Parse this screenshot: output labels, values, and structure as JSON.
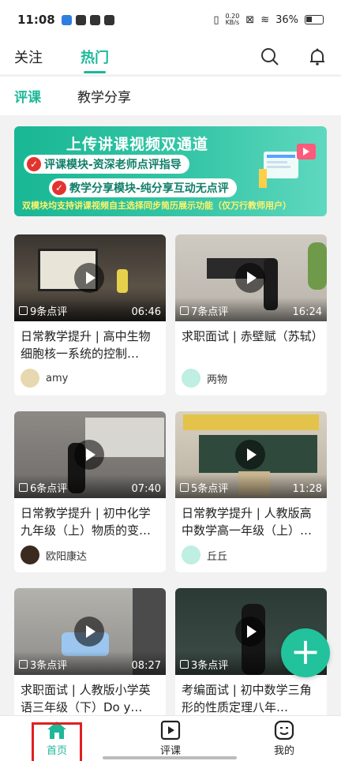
{
  "status_bar": {
    "time": "11:08",
    "net_rate_value": "0.20",
    "net_rate_unit": "KB/s",
    "battery": "36%"
  },
  "top_tabs": [
    {
      "label": "关注"
    },
    {
      "label": "热门"
    }
  ],
  "sub_tabs": [
    {
      "label": "评课"
    },
    {
      "label": "教学分享"
    }
  ],
  "banner": {
    "title": "上传讲课视频双通道",
    "line1": "评课模块-资深老师点评指导",
    "line2": "教学分享模块-纯分享互动无点评",
    "note": "双模块均支持讲课视频自主选择同步简历展示功能（仅万行教师用户）"
  },
  "cards": [
    {
      "comments": "9条点评",
      "duration": "06:46",
      "title": "日常教学提升 | 高中生物细胞核一系统的控制…",
      "author": "amy"
    },
    {
      "comments": "7条点评",
      "duration": "16:24",
      "title": "求职面试 | 赤壁赋（苏轼）",
      "author": "两物"
    },
    {
      "comments": "6条点评",
      "duration": "07:40",
      "title": "日常教学提升 | 初中化学九年级（上）物质的变…",
      "author": "欧阳康达"
    },
    {
      "comments": "5条点评",
      "duration": "11:28",
      "title": "日常教学提升 | 人教版高中数学高一年级（上）…",
      "author": "丘丘"
    },
    {
      "comments": "3条点评",
      "duration": "08:27",
      "title": "求职面试 | 人教版小学英语三年级（下）Do y…",
      "author": ""
    },
    {
      "comments": "3条点评",
      "duration": "",
      "title": "考编面试 | 初中数学三角形的性质定理八年…",
      "author": ""
    }
  ],
  "fab": "+",
  "bottom_nav": [
    {
      "label": "首页"
    },
    {
      "label": "评课"
    },
    {
      "label": "我的"
    }
  ],
  "colors": {
    "accent": "#1db899",
    "highlight": "#e02020"
  },
  "icons": [
    "search-icon",
    "bell-icon",
    "play-icon",
    "comment-icon",
    "home-icon",
    "video-icon",
    "profile-icon",
    "plus-icon"
  ]
}
